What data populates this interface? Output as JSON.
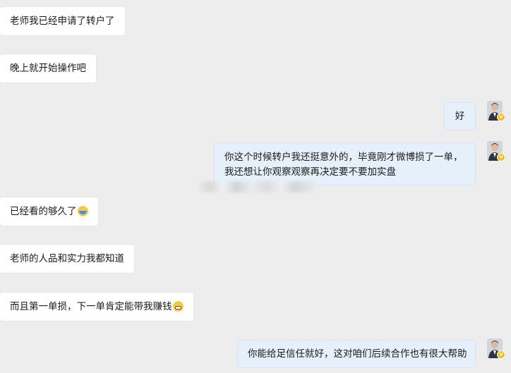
{
  "messages": [
    {
      "id": "m1",
      "side": "left",
      "text": "老师我已经申请了转户了"
    },
    {
      "id": "m2",
      "side": "left",
      "text": "晚上就开始操作吧"
    },
    {
      "id": "m3",
      "side": "right",
      "text": "好"
    },
    {
      "id": "m4",
      "side": "right",
      "line1": "你这个时候转户我还挺意外的，毕竟刚才微博损了一单，",
      "line2": "我还想让你观察观察再决定要不要加实盘"
    },
    {
      "id": "m5",
      "side": "left",
      "text": "已经看的够久了",
      "emoji": "sweat-smile-icon"
    },
    {
      "id": "m6",
      "side": "left",
      "text": "老师的人品和实力我都知道"
    },
    {
      "id": "m7",
      "side": "left",
      "text": "而且第一单损，下一单肯定能带我赚钱",
      "emoji": "grin-icon"
    },
    {
      "id": "m8",
      "side": "right",
      "text": "你能给足信任就好，这对咱们后续合作也有很大帮助"
    }
  ],
  "avatar": {
    "badge": "V"
  },
  "colors": {
    "background": "#ededed",
    "left_bubble": "#ffffff",
    "right_bubble": "#e6f0fb",
    "badge": "#f5b81c"
  }
}
